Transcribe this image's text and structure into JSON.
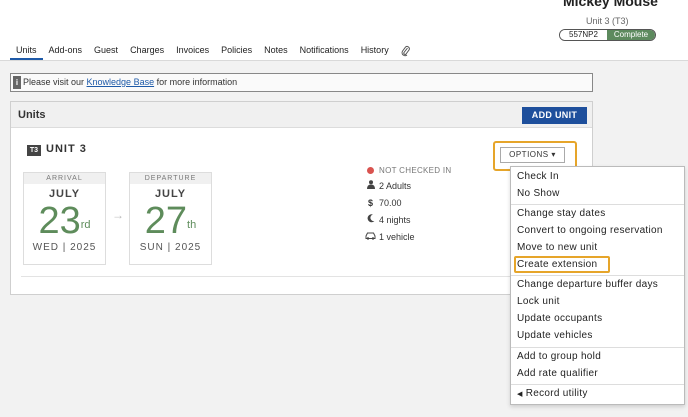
{
  "header": {
    "guest_name": "Mickey Mouse",
    "unit_sub": "Unit 3 (T3)",
    "confirmation_code": "557NP2",
    "status": "Complete"
  },
  "tabs": [
    {
      "label": "Units",
      "active": true
    },
    {
      "label": "Add-ons"
    },
    {
      "label": "Guest"
    },
    {
      "label": "Charges"
    },
    {
      "label": "Invoices"
    },
    {
      "label": "Policies"
    },
    {
      "label": "Notes"
    },
    {
      "label": "Notifications"
    },
    {
      "label": "History"
    }
  ],
  "attachment_icon": "paperclip-icon",
  "knowledge_bar": {
    "prefix": "Please visit our ",
    "link": "Knowledge Base",
    "suffix": " for more information",
    "icon": "info-icon"
  },
  "units_panel": {
    "title": "Units",
    "add_unit_label": "ADD UNIT",
    "unit_badge": "T3",
    "unit_name": "UNIT 3",
    "options_label": "OPTIONS ▾",
    "arrival": {
      "label": "ARRIVAL",
      "month": "JULY",
      "day": "23",
      "suffix": "rd",
      "weekday": "WED | 2025"
    },
    "departure": {
      "label": "DEPARTURE",
      "month": "JULY",
      "day": "27",
      "suffix": "th",
      "weekday": "SUN | 2025"
    },
    "arrow": "→",
    "status_text": "NOT CHECKED IN",
    "adults": "2 Adults",
    "rate": "70.00",
    "nights": "4 nights",
    "vehicles": "1 vehicle"
  },
  "dropdown": {
    "items": [
      "Check In",
      "No Show",
      "Change stay dates",
      "Convert to ongoing reservation",
      "Move to new unit",
      "Create extension",
      "Change departure buffer days",
      "Lock unit",
      "Update occupants",
      "Update vehicles",
      "Add to group hold",
      "Add rate qualifier",
      "Record utility"
    ],
    "highlighted": "Create extension"
  },
  "colors": {
    "accent": "#1e4f9c",
    "complete_green": "#5d8a5e",
    "date_green": "#5e8c5b",
    "highlight": "#e6a52a",
    "status_red": "#d9534f"
  }
}
